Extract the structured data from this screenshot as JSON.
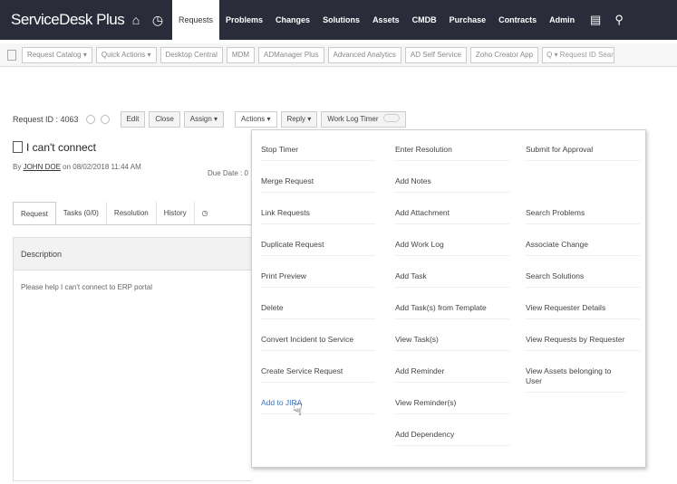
{
  "app": {
    "logo": "ServiceDesk Plus"
  },
  "nav": [
    "Requests",
    "Problems",
    "Changes",
    "Solutions",
    "Assets",
    "CMDB",
    "Purchase",
    "Contracts",
    "Admin"
  ],
  "subbar": {
    "items": [
      "Request Catalog  ▾",
      "Quick Actions  ▾",
      "Desktop Central",
      "MDM",
      "ADManager Plus",
      "Advanced Analytics",
      "AD Self Service",
      "Zoho Creator App"
    ],
    "search_placeholder": "Q ▾ Request ID Search"
  },
  "toolbar": {
    "request_id": "Request ID : 4063",
    "edit": "Edit",
    "close": "Close",
    "assign": "Assign ▾",
    "actions": "Actions ▾",
    "reply": "Reply ▾",
    "worklog": "Work Log Timer"
  },
  "request": {
    "title": "I can't connect",
    "by_prefix": "By",
    "requester": "JOHN DOE",
    "on_date": "on 08/02/2018 11:44 AM",
    "due_date": "Due Date : 0"
  },
  "tabs": [
    "Request",
    "Tasks (0/0)",
    "Resolution",
    "History"
  ],
  "description": {
    "header": "Description",
    "text": "Please help I can't connect to ERP portal"
  },
  "menu": {
    "col1": [
      "Stop Timer",
      "Merge Request",
      "Link Requests",
      "Duplicate Request",
      "Print Preview",
      "Delete",
      "Convert Incident to Service",
      "Create Service Request",
      "Add to JIRA"
    ],
    "col2": [
      "Enter Resolution",
      "Add Notes",
      "Add Attachment",
      "Add Work Log",
      "Add Task",
      "Add Task(s) from Template",
      "View Task(s)",
      "Add Reminder",
      "View Reminder(s)",
      "Add Dependency"
    ],
    "col3": [
      "Submit for Approval",
      "",
      "Search Problems",
      "Associate Change",
      "Search Solutions",
      "View Requester Details",
      "View Requests by Requester",
      "View Assets belonging to User"
    ]
  }
}
